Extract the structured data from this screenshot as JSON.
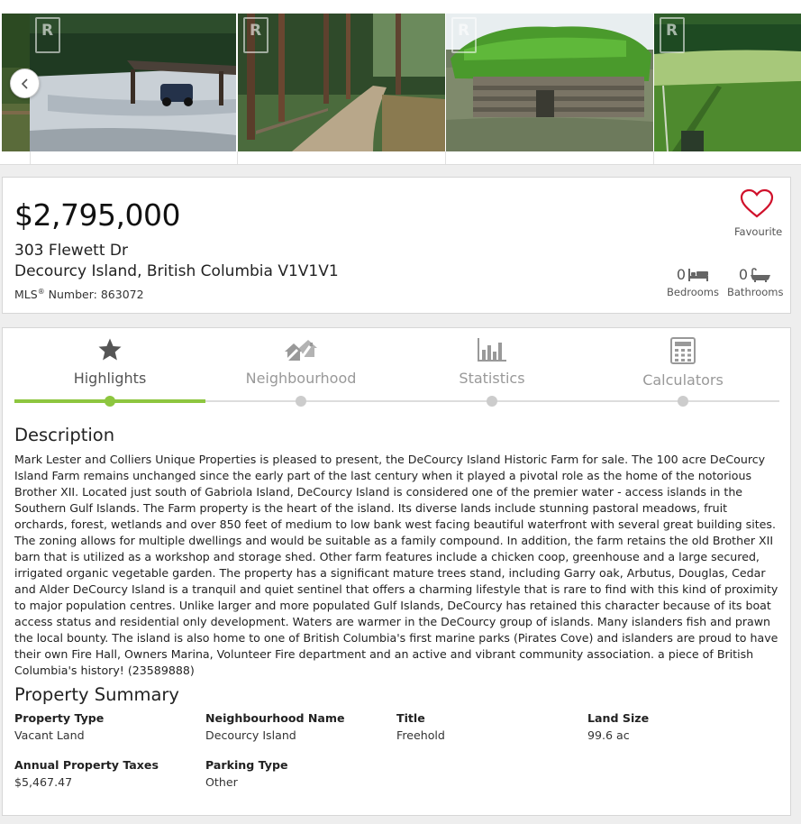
{
  "gallery": {
    "prev_icon": "chevron-left-icon",
    "photos": [
      {
        "name": "farm-shed-photo"
      },
      {
        "name": "forest-road-photo"
      },
      {
        "name": "sod-roof-cabin-photo"
      },
      {
        "name": "garden-field-photo"
      }
    ]
  },
  "listing": {
    "price": "$2,795,000",
    "address_line1": "303 Flewett Dr",
    "address_line2": "Decourcy Island, British Columbia V1V1V1",
    "mls_label": "MLS",
    "mls_mark": "®",
    "mls_suffix": " Number: 863072",
    "favourite_label": "Favourite",
    "bedrooms_count": "0",
    "bedrooms_label": "Bedrooms",
    "bathrooms_count": "0",
    "bathrooms_label": "Bathrooms"
  },
  "tabs": [
    {
      "label": "Highlights",
      "icon": "star-icon",
      "active": true
    },
    {
      "label": "Neighbourhood",
      "icon": "neighbourhood-icon",
      "active": false
    },
    {
      "label": "Statistics",
      "icon": "bar-chart-icon",
      "active": false
    },
    {
      "label": "Calculators",
      "icon": "calculator-icon",
      "active": false
    }
  ],
  "description": {
    "heading": "Description",
    "text": "Mark Lester and Colliers Unique Properties is pleased to present, the DeCourcy Island Historic Farm for sale. The 100 acre DeCourcy Island Farm remains unchanged since the early part of the last century when it played a pivotal role as the home of the notorious Brother XII. Located just south of Gabriola Island, DeCourcy Island is considered one of the premier water - access islands in the Southern Gulf Islands. The Farm property is the heart of the island. Its diverse lands include stunning pastoral meadows, fruit orchards, forest, wetlands and over 850 feet of medium to low bank west facing beautiful waterfront with several great building sites. The zoning allows for multiple dwellings and would be suitable as a family compound. In addition, the farm retains the old Brother XII barn that is utilized as a workshop and storage shed. Other farm features include a chicken coop, greenhouse and a large secured, irrigated organic vegetable garden. The property has a significant mature trees stand, including Garry oak, Arbutus, Douglas, Cedar and Alder DeCourcy Island is a tranquil and quiet sentinel that offers a charming lifestyle that is rare to find with this kind of proximity to major population centres. Unlike larger and more populated Gulf Islands, DeCourcy has retained this character because of its boat access status and residential only development. Waters are warmer in the DeCourcy group of islands. Many islanders fish and prawn the local bounty. The island is also home to one of British Columbia's first marine parks (Pirates Cove) and islanders are proud to have their own Fire Hall, Owners Marina, Volunteer Fire department and an active and vibrant community association. a piece of British Columbia's history! (23589888)"
  },
  "summary": {
    "heading": "Property Summary",
    "items": [
      {
        "label": "Property Type",
        "value": "Vacant Land"
      },
      {
        "label": "Neighbourhood Name",
        "value": "Decourcy Island"
      },
      {
        "label": "Title",
        "value": "Freehold"
      },
      {
        "label": "Land Size",
        "value": "99.6 ac"
      },
      {
        "label": "Annual Property Taxes",
        "value": "$5,467.47"
      },
      {
        "label": "Parking Type",
        "value": "Other"
      }
    ]
  },
  "colors": {
    "accent_green": "#8dc63f",
    "favourite_red": "#d0112b",
    "inactive_grey": "#cccccc"
  }
}
